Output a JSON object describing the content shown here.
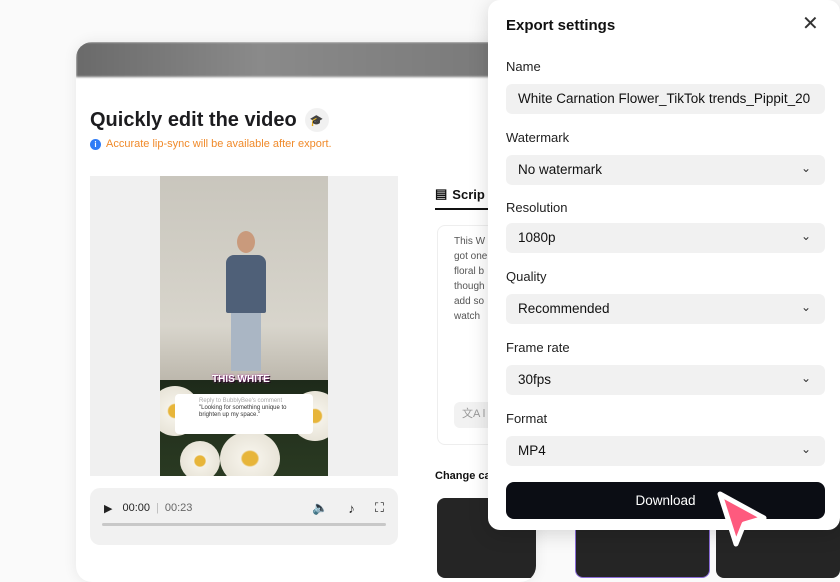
{
  "editor": {
    "title": "Quickly edit the video",
    "notice": "Accurate lip-sync will be available after export.",
    "video": {
      "caption": "THIS WHITE",
      "reply_title": "Reply to BubblyBee's comment",
      "reply_text": "\"Looking for something unique to brighten up my space.\""
    },
    "player": {
      "current": "00:00",
      "separator": "|",
      "duration": "00:23",
      "progress": 0
    },
    "script_tab": "Scrip",
    "script_lines": [
      "This W",
      "got one",
      "floral b",
      "though",
      "add so",
      "watch"
    ],
    "translate_label": "l",
    "change_caption": "Change ca"
  },
  "export": {
    "title": "Export settings",
    "fields": [
      {
        "label": "Name",
        "value": "White Carnation Flower_TikTok trends_Pippit_20"
      },
      {
        "label": "Watermark",
        "value": "No watermark"
      },
      {
        "label": "Resolution",
        "value": "1080p"
      },
      {
        "label": "Quality",
        "value": "Recommended"
      },
      {
        "label": "Frame rate",
        "value": "30fps"
      },
      {
        "label": "Format",
        "value": "MP4"
      }
    ],
    "download": "Download"
  },
  "colors": {
    "accent": "#fe5a7e",
    "notice": "#f08a2a",
    "button": "#0b0d14"
  }
}
